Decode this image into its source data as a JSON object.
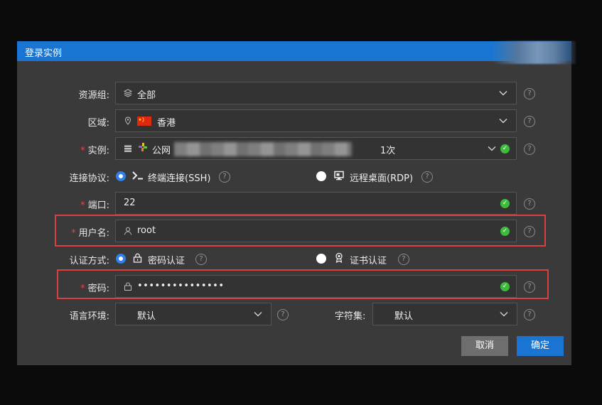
{
  "dialog": {
    "title": "登录实例"
  },
  "resource_group": {
    "label": "资源组:",
    "value": "全部"
  },
  "region": {
    "label": "区域:",
    "value": "香港",
    "flag": "cn-flag"
  },
  "instance": {
    "required_mark": "*",
    "label": "实例:",
    "value": "公网",
    "badge": "1次"
  },
  "protocol": {
    "label": "连接协议:",
    "options": [
      {
        "label": "终端连接(SSH)",
        "selected": true,
        "icon": "terminal-icon"
      },
      {
        "label": "远程桌面(RDP)",
        "selected": false,
        "icon": "desktop-icon"
      }
    ]
  },
  "port": {
    "required_mark": "*",
    "label": "端口:",
    "value": "22"
  },
  "username": {
    "required_mark": "*",
    "label": "用户名:",
    "value": "root"
  },
  "auth": {
    "label": "认证方式:",
    "options": [
      {
        "label": "密码认证",
        "selected": true,
        "icon": "lock-icon"
      },
      {
        "label": "证书认证",
        "selected": false,
        "icon": "certificate-icon"
      }
    ]
  },
  "password": {
    "required_mark": "*",
    "label": "密码:",
    "value": "•••••••••••••••"
  },
  "locale": {
    "label": "语言环境:",
    "value": "默认"
  },
  "charset": {
    "label": "字符集:",
    "value": "默认"
  },
  "buttons": {
    "cancel": "取消",
    "confirm": "确定"
  },
  "colors": {
    "accent": "#1a75d2",
    "success": "#3dbb3d",
    "required": "#e54545",
    "highlight": "#d94040"
  }
}
